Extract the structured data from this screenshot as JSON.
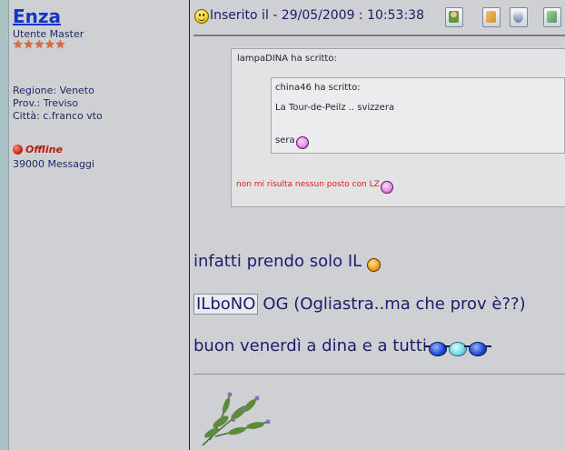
{
  "user": {
    "name": "Enza",
    "role": "Utente Master",
    "stars": [
      "★",
      "★",
      "★",
      "★",
      "★"
    ],
    "region": "Regione: Veneto",
    "province": "Prov.: Treviso",
    "city": "Città: c.franco vto",
    "status": "Offline",
    "messages": "39000 Messaggi"
  },
  "post": {
    "posted_text": "Inserito il - 29/05/2009 : 10:53:38",
    "toolbar": [
      {
        "name": "profile-icon",
        "color": "#5f9a3c"
      },
      {
        "name": "home-icon",
        "color": "#d5902d"
      },
      {
        "name": "email-icon",
        "color": "#6f7ea6"
      },
      {
        "name": "reply-icon",
        "color": "#4c9a56"
      }
    ],
    "quote": {
      "outer_author": "lampaDINA ha scritto:",
      "inner_author": "china46 ha scritto:",
      "inner_text1": "La Tour-de-Peilz .. svizzera",
      "inner_text2": "sera",
      "outer_reply": "non mi risulta nessun posto con LZ"
    },
    "body": {
      "line1": "infatti prendo solo IL",
      "line2_highlight": "ILboNO",
      "line2_rest": "OG (Ogliastra..ma che prov è??)",
      "line3": "buon venerdì a dina e a tutti"
    }
  },
  "colors": {
    "username": "#1433c9",
    "offline": "#b51c14",
    "body_text": "#1a1d6b",
    "quote_red": "#d6201b"
  }
}
